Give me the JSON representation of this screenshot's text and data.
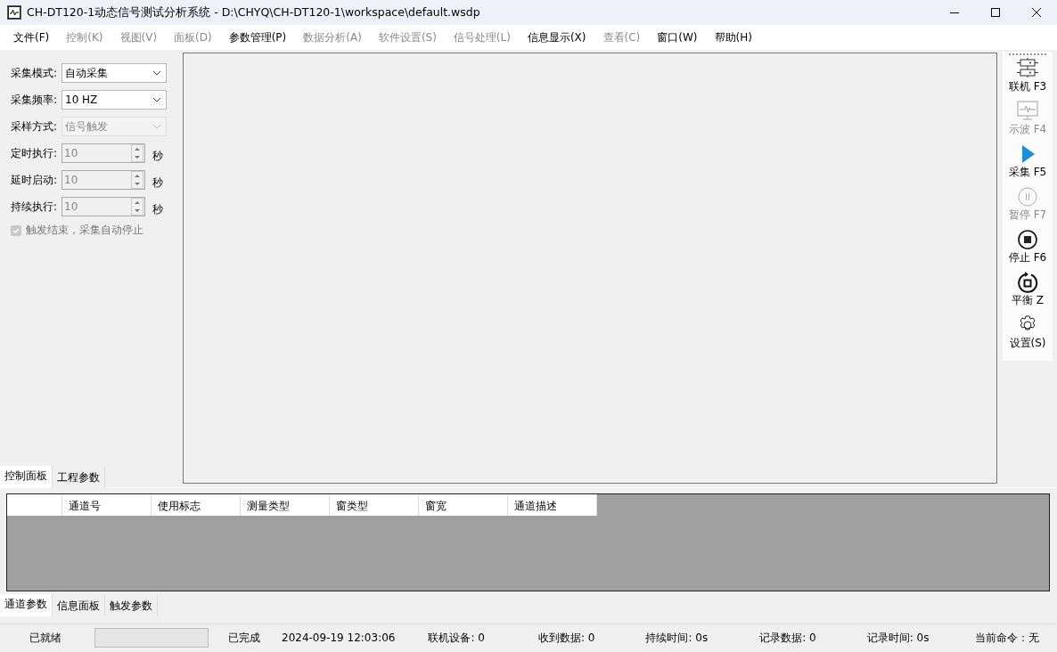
{
  "window": {
    "title": "CH-DT120-1动态信号测试分析系统 - D:\\CHYQ\\CH-DT120-1\\workspace\\default.wsdp"
  },
  "menu": [
    {
      "label": "文件(F)",
      "disabled": false
    },
    {
      "label": "控制(K)",
      "disabled": true
    },
    {
      "label": "视图(V)",
      "disabled": true
    },
    {
      "label": "面板(D)",
      "disabled": true
    },
    {
      "label": "参数管理(P)",
      "disabled": false
    },
    {
      "label": "数据分析(A)",
      "disabled": true
    },
    {
      "label": "软件设置(S)",
      "disabled": true
    },
    {
      "label": "信号处理(L)",
      "disabled": true
    },
    {
      "label": "信息显示(X)",
      "disabled": false
    },
    {
      "label": "查看(C)",
      "disabled": true
    },
    {
      "label": "窗口(W)",
      "disabled": false
    },
    {
      "label": "帮助(H)",
      "disabled": false
    }
  ],
  "control_panel": {
    "fields": [
      {
        "kind": "select",
        "label": "采集模式:",
        "value": "自动采集",
        "disabled": false
      },
      {
        "kind": "select",
        "label": "采集频率:",
        "value": "10 HZ",
        "disabled": false
      },
      {
        "kind": "select",
        "label": "采样方式:",
        "value": "信号触发",
        "disabled": true
      },
      {
        "kind": "spin",
        "label": "定时执行:",
        "value": "10",
        "unit": "秒",
        "disabled": true
      },
      {
        "kind": "spin",
        "label": "延时启动:",
        "value": "10",
        "unit": "秒",
        "disabled": true
      },
      {
        "kind": "spin",
        "label": "持续执行:",
        "value": "10",
        "unit": "秒",
        "disabled": true
      }
    ],
    "checkbox": {
      "label": "触发结束，采集自动停止",
      "checked": true,
      "disabled": true
    }
  },
  "left_tabs": [
    {
      "label": "控制面板",
      "selected": true
    },
    {
      "label": "工程参数",
      "selected": false
    }
  ],
  "toolbar": [
    {
      "kind": "connect",
      "label": "联机 F3",
      "disabled": false
    },
    {
      "kind": "scope",
      "label": "示波 F4",
      "disabled": true
    },
    {
      "kind": "play",
      "label": "采集 F5",
      "disabled": false
    },
    {
      "kind": "pause",
      "label": "暂停 F7",
      "disabled": true
    },
    {
      "kind": "stop",
      "label": "停止 F6",
      "disabled": false
    },
    {
      "kind": "balance",
      "label": "平衡 Z",
      "disabled": false
    },
    {
      "kind": "settings",
      "label": "设置(S)",
      "disabled": false
    }
  ],
  "table": {
    "columns": [
      "通道号",
      "使用标志",
      "测量类型",
      "窗类型",
      "窗宽",
      "通道描述"
    ]
  },
  "bottom_tabs": [
    {
      "label": "通道参数",
      "selected": true
    },
    {
      "label": "信息面板",
      "selected": false
    },
    {
      "label": "触发参数",
      "selected": false
    }
  ],
  "status_bar": {
    "status": "已就绪",
    "progress": {
      "level": 0
    },
    "state": "已完成",
    "time": "2024-09-19 12:03:06",
    "items": [
      "联机设备: 0",
      "收到数据: 0",
      "持续时间: 0s",
      "记录数据: 0",
      "记录时间: 0s",
      "当前命令：无"
    ]
  }
}
